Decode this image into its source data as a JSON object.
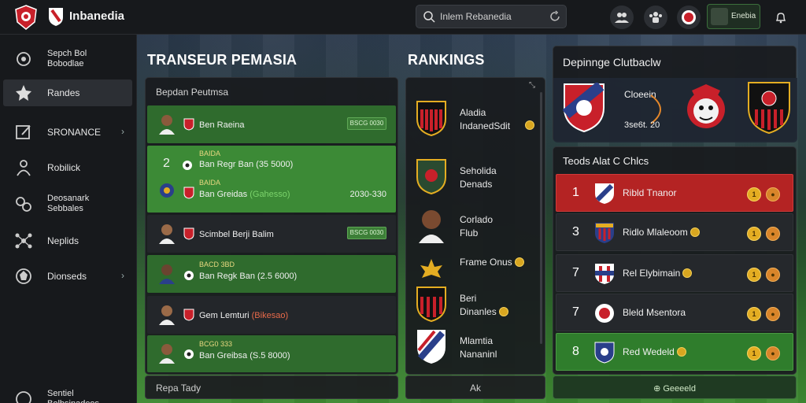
{
  "app": {
    "title": "Inbanedia"
  },
  "search": {
    "text": "Inlem Rebanedia"
  },
  "profile": {
    "name": "Enebia"
  },
  "sidebar": {
    "items": [
      {
        "label": "Sepch Bol\nBobodlae",
        "icon": "football-players-icon"
      },
      {
        "label": "Randes",
        "icon": "star-icon"
      },
      {
        "label": "SRONANCE",
        "icon": "edit-icon"
      },
      {
        "label": "Robilick",
        "icon": "people-icon"
      },
      {
        "label": "Deosanark\nSebbales",
        "icon": "gear-group-icon"
      },
      {
        "label": "Neplids",
        "icon": "network-icon"
      },
      {
        "label": "Dionseds",
        "icon": "ball-icon"
      }
    ],
    "footer": "Sentiel\nBolbsinadeos"
  },
  "transfer": {
    "title": "TRANSEUR PEMASIA",
    "head": "Bepdan Peutmsa",
    "rows": [
      {
        "style": "green",
        "name": "Ben Raeina",
        "badge": "BSCG 0030"
      },
      {
        "style": "bright",
        "rank": "2",
        "sub": "BAIDA",
        "name": "Ban Regr Ban (35 5000)",
        "name2": "Ban Greidas",
        "tag2": "(Gahesso)",
        "sub2": "BAIDA",
        "fee": "2030-330"
      },
      {
        "style": "dark",
        "name": "Scimbel Berji Balim",
        "badge": "BSCG 0030"
      },
      {
        "style": "green",
        "sub": "BACD 3BD",
        "name": "Ban Regk Ban (2.5 6000)"
      },
      {
        "style": "dark",
        "name": "Gem Lemturi",
        "tag": "(Bikesao)"
      },
      {
        "style": "green",
        "sub": "BCG0 333",
        "name": "Ban Greibsa (S.5 8000)"
      }
    ],
    "footer": "Repa Tady"
  },
  "rankings": {
    "title": "RANKINGS",
    "items": [
      {
        "text": "Aladia\nIndanedSdit"
      },
      {
        "text": "Seholida\nDenads"
      },
      {
        "text": "Corlado\nFlub"
      },
      {
        "text": "Frame Onus"
      },
      {
        "text": "Beri\nDinanles"
      },
      {
        "text": "Mlamtia\nNananinl"
      }
    ],
    "footer": "Ak"
  },
  "deposit": {
    "title": "Depinnge Clutbaclw",
    "club": "Cloeein",
    "score": "3se6t. 20"
  },
  "teams": {
    "title": "Teods Alat C Chlcs",
    "rows": [
      {
        "rank": "1",
        "name": "Ribld Tnanor",
        "style": "red"
      },
      {
        "rank": "3",
        "name": "Ridlo Mlaleoom",
        "style": "dark"
      },
      {
        "rank": "7",
        "name": "Rel Elybimain",
        "style": "dark"
      },
      {
        "rank": "7",
        "name": "Bleld Msentora",
        "style": "dark"
      },
      {
        "rank": "8",
        "name": "Red Wedeld",
        "style": "green"
      }
    ],
    "footer": "Geeeeld"
  },
  "colors": {
    "accent_green": "#3c8a36",
    "accent_red": "#b42323",
    "coin": "#e4ad22"
  }
}
